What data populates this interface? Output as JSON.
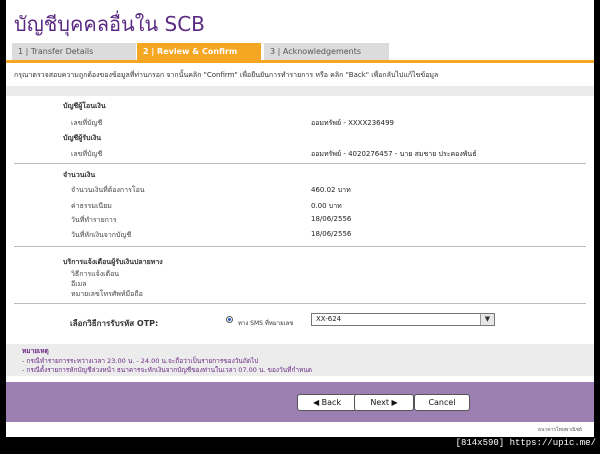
{
  "page_title": "บัญชีบุคคลอื่นใน SCB",
  "tabs": [
    {
      "label": "1 | Transfer Details"
    },
    {
      "label": "2 | Review & Confirm"
    },
    {
      "label": "3 | Acknowledgements"
    }
  ],
  "instruction": "กรุณาตรวจสอบความถูกต้องของข้อมูลที่ท่านกรอก จากนั้นคลิก \"Confirm\" เพื่อยืนยันการทำรายการ หรือ คลิก \"Back\" เพื่อกลับไปแก้ไขข้อมูล",
  "from_account": {
    "heading": "บัญชีผู้โอนเงิน",
    "label": "เลขที่บัญชี",
    "value": "ออมทรัพย์ - XXXX236499"
  },
  "to_account": {
    "heading": "บัญชีผู้รับเงิน",
    "label": "เลขที่บัญชี",
    "value": "ออมทรัพย์ - 4020276457 - นาย สมชาย ประคองพันธ์"
  },
  "amount": {
    "heading": "จำนวนเงิน",
    "rows": [
      {
        "label": "จำนวนเงินที่ต้องการโอน",
        "value": "460.02  บาท"
      },
      {
        "label": "ค่าธรรมเนียม",
        "value": "0.00  บาท"
      },
      {
        "label": "วันที่ทำรายการ",
        "value": "18/06/2556"
      },
      {
        "label": "วันที่หักเงินจากบัญชี",
        "value": "18/06/2556"
      }
    ]
  },
  "notify": {
    "heading": "บริการแจ้งเตือนผู้รับเงินปลายทาง",
    "rows": [
      "วิธีการแจ้งเตือน",
      "อีเมล",
      "หมายเลขโทรศัพท์มือถือ"
    ]
  },
  "otp": {
    "label": "เลือกวิธีการรับรหัส OTP:",
    "option_text": "ทาง SMS ที่หมายเลข",
    "selected": "XX-624"
  },
  "notes": {
    "heading": "หมายเหตุ",
    "items": [
      "- กรณีทำรายการระหว่างเวลา 23.00 น. - 24.00 น.จะถือว่าเป็นรายการของวันถัดไป",
      "- กรณีตั้งรายการหักบัญชีล่วงหน้า ธนาคารจะหักเงินจากบัญชีของท่านในเวลา 07.00 น. ของวันที่กำหนด"
    ]
  },
  "buttons": {
    "back": "◀ Back",
    "next": "Next ▶",
    "cancel": "Cancel"
  },
  "footer": "ธนาคารไทยพาณิชย์",
  "watermark": "[814x590] https://upic.me/",
  "colors": {
    "brand_purple": "#5a2a82",
    "tab_active": "#f5a623",
    "action_bar": "#9a7fb0"
  }
}
